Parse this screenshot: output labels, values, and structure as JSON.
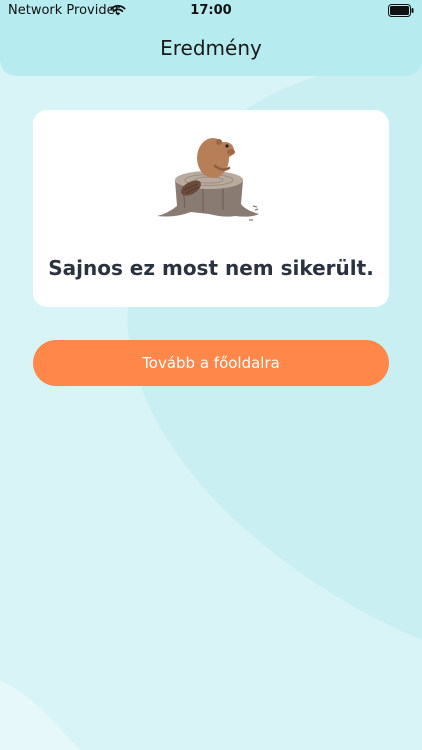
{
  "status_bar": {
    "carrier": "Network Provider",
    "time": "17:00",
    "wifi_icon": "wifi-icon",
    "battery_icon": "battery-icon"
  },
  "header": {
    "title": "Eredmény"
  },
  "result": {
    "illustration": "beaver-on-stump-illustration",
    "message": "Sajnos ez most nem sikerült."
  },
  "actions": {
    "home_button_label": "Tovább a főoldalra"
  },
  "colors": {
    "background": "#d8f4f6",
    "header": "#b6ecef",
    "card": "#ffffff",
    "button": "#ff874a",
    "message_text": "#2c3340"
  }
}
